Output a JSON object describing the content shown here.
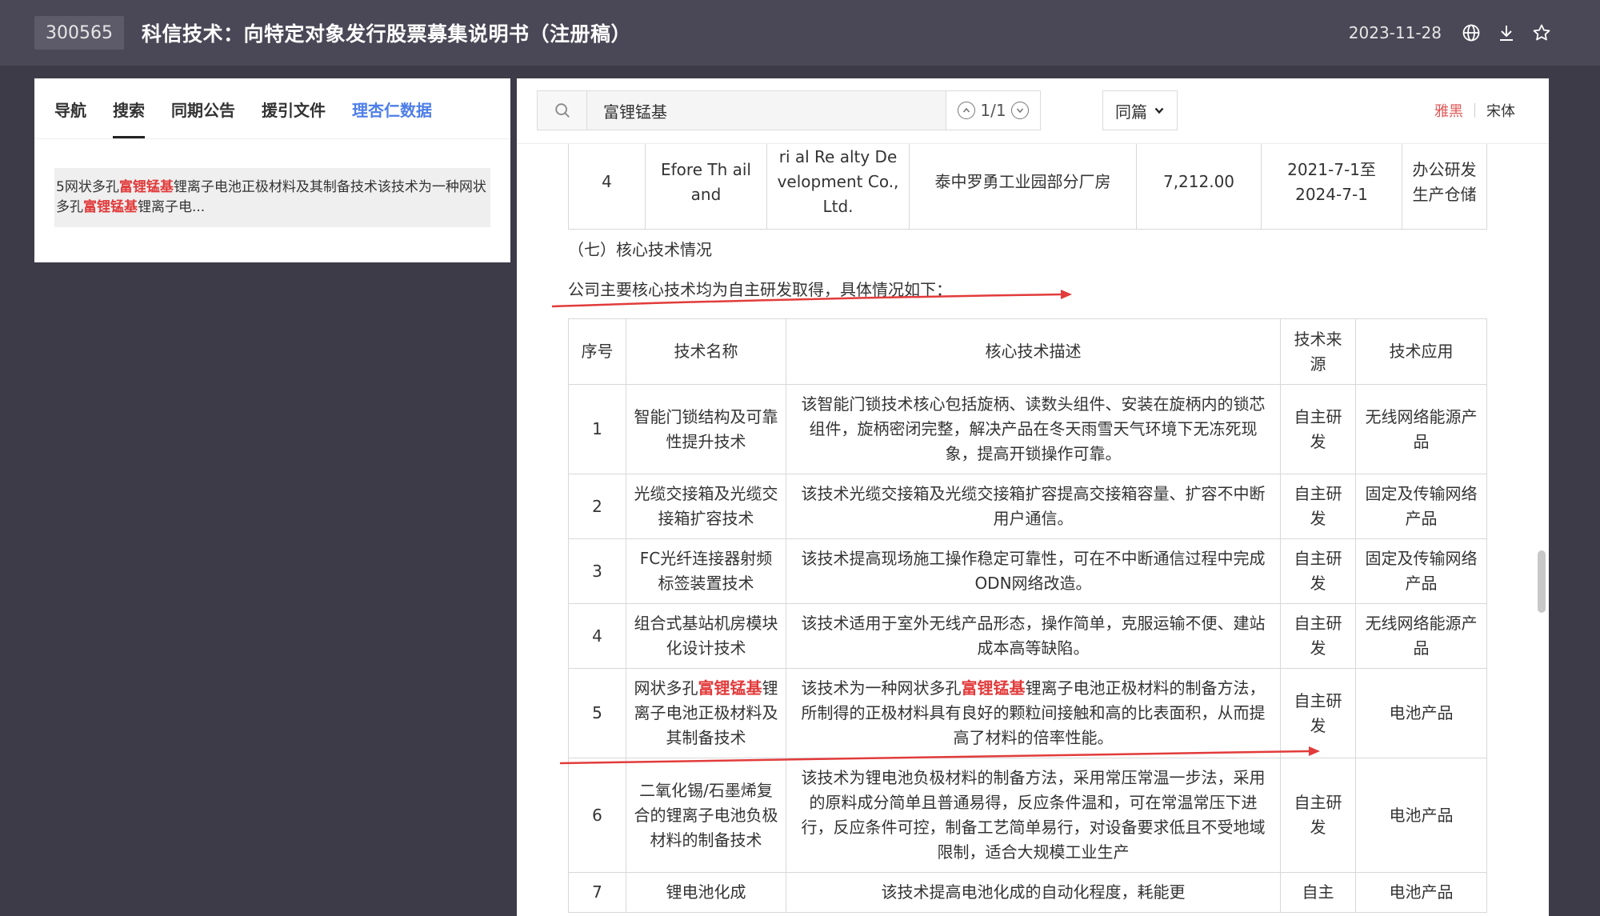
{
  "header": {
    "code": "300565",
    "title": "科信技术：向特定对象发行股票募集说明书（注册稿）",
    "date": "2023-11-28",
    "icons": [
      "globe-icon",
      "download-icon",
      "star-icon"
    ]
  },
  "left_panel": {
    "tabs": [
      {
        "label": "导航"
      },
      {
        "label": "搜索"
      },
      {
        "label": "同期公告"
      },
      {
        "label": "援引文件"
      },
      {
        "label": "理杏仁数据"
      }
    ],
    "active_tab": "搜索",
    "result": {
      "prefix_1": "5网状多孔",
      "hit_1": "富锂锰基",
      "middle": "锂离子电池正极材料及其制备技术该技术为一种网状多孔",
      "hit_2": "富锂锰基",
      "suffix": "锂离子电..."
    }
  },
  "search": {
    "query": "富锂锰基",
    "match_count": "1/1",
    "scope": "同篇",
    "fonts": [
      "雅黑",
      "宋体"
    ],
    "active_font": "雅黑"
  },
  "document": {
    "top_row": {
      "no": "4",
      "col2": "Efore Th ail and",
      "col3": "ri al Re alty De velopment Co., Ltd.",
      "col4": "泰中罗勇工业园部分厂房",
      "col5": "7,212.00",
      "col6": "2021-7-1至2024-7-1",
      "col7": "办公研发生产仓储"
    },
    "section_heading": "（七）核心技术情况",
    "intro": "公司主要核心技术均为自主研发取得，具体情况如下：",
    "table_header": {
      "no": "序号",
      "name": "技术名称",
      "desc": "核心技术描述",
      "source": "技术来源",
      "app": "技术应用"
    },
    "rows": [
      {
        "no": "1",
        "name": "智能门锁结构及可靠性提升技术",
        "desc": "该智能门锁技术核心包括旋柄、读数头组件、安装在旋柄内的锁芯组件，旋柄密闭完整，解决产品在冬天雨雪天气环境下无冻死现象，提高开锁操作可靠。",
        "source": "自主研发",
        "app": "无线网络能源产品"
      },
      {
        "no": "2",
        "name": "光缆交接箱及光缆交接箱扩容技术",
        "desc": "该技术光缆交接箱及光缆交接箱扩容提高交接箱容量、扩容不中断用户通信。",
        "source": "自主研发",
        "app": "固定及传输网络产品"
      },
      {
        "no": "3",
        "name": "FC光纤连接器射频标签装置技术",
        "desc": "该技术提高现场施工操作稳定可靠性，可在不中断通信过程中完成ODN网络改造。",
        "source": "自主研发",
        "app": "固定及传输网络产品"
      },
      {
        "no": "4",
        "name": "组合式基站机房模块化设计技术",
        "desc": "该技术适用于室外无线产品形态，操作简单，克服运输不便、建站成本高等缺陷。",
        "source": "自主研发",
        "app": "无线网络能源产品"
      },
      {
        "no": "5",
        "name_pre": "网状多孔",
        "name_hit": "富锂锰基",
        "name_post": "锂离子电池正极材料及其制备技术",
        "desc_pre": "该技术为一种网状多孔",
        "desc_hit": "富锂锰基",
        "desc_post": "锂离子电池正极材料的制备方法，所制得的正极材料具有良好的颗粒间接触和高的比表面积，从而提高了材料的倍率性能。",
        "source": "自主研发",
        "app": "电池产品"
      },
      {
        "no": "6",
        "name": "二氧化锡/石墨烯复合的锂离子电池负极材料的制备技术",
        "desc": "该技术为锂电池负极材料的制备方法，采用常压常温一步法，采用的原料成分简单且普通易得，反应条件温和，可在常温常压下进行，反应条件可控，制备工艺简单易行，对设备要求低且不受地域限制，适合大规模工业生产",
        "source": "自主研发",
        "app": "电池产品"
      },
      {
        "no": "7",
        "name": "锂电池化成",
        "desc": "该技术提高电池化成的自动化程度，耗能更",
        "source": "自主",
        "app": "电池产品"
      }
    ]
  }
}
